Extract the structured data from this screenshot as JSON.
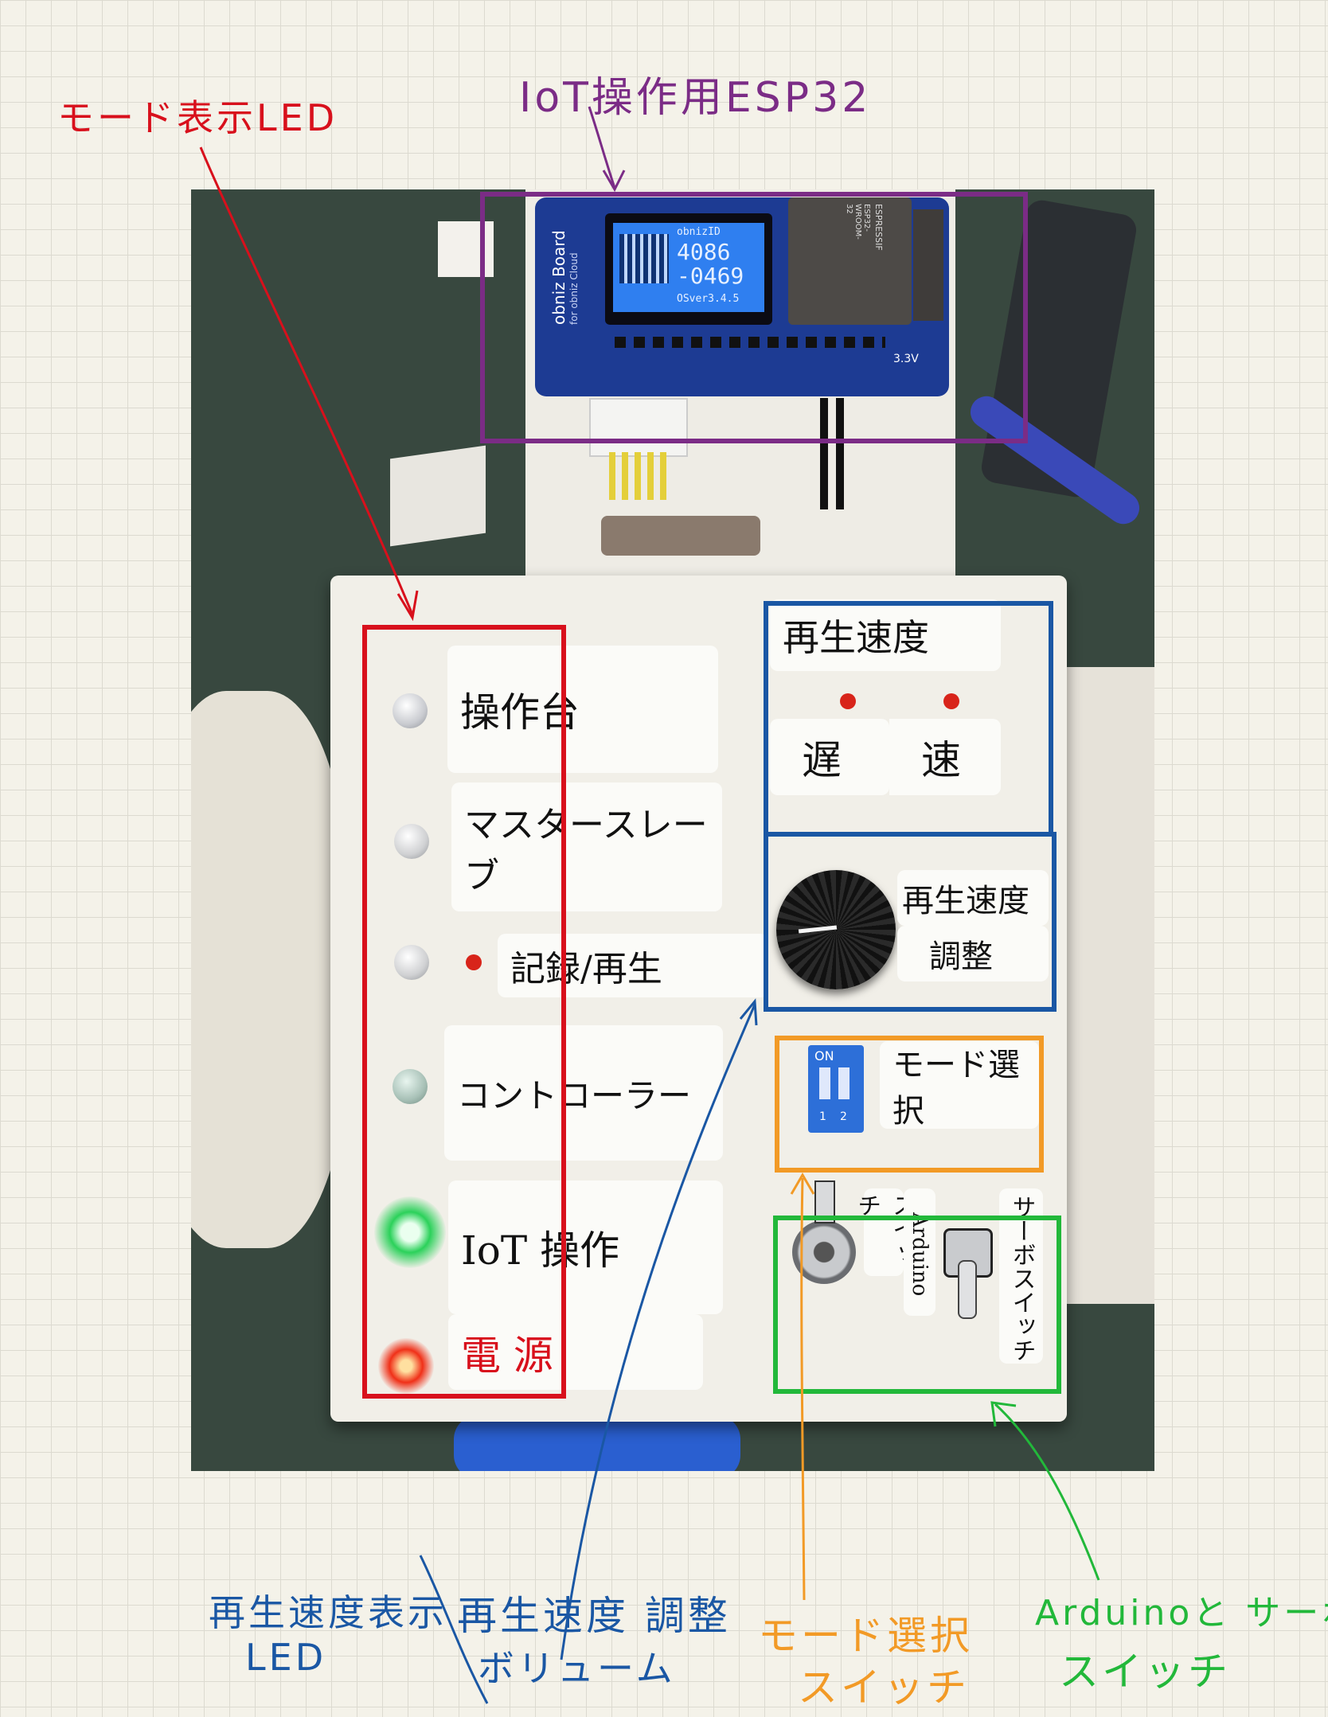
{
  "annotations": {
    "mode_led": "モード表示LED",
    "esp32": "IoT操作用ESP32",
    "speed_led_line1": "再生速度表示",
    "speed_led_line2": "LED",
    "speed_volume_line1": "再生速度 調整",
    "speed_volume_line2": "ボリューム",
    "mode_switch_line1": "モード選択",
    "mode_switch_line2": "スイッチ",
    "arduino_servo_line1": "Arduinoと サーボ",
    "arduino_servo_line2": "スイッチ"
  },
  "board": {
    "brand": "obniz Board",
    "cloud": "for obniz Cloud",
    "obniz_id_label": "obnizID",
    "obniz_id_1": "4086",
    "obniz_id_2": "-0469",
    "os_version": "OSver3.4.5",
    "module_brand": "ESPRESSIF",
    "module_model": "ESP32-WROOM-32",
    "pin_label": "3.3V"
  },
  "panel_labels": {
    "console": "操作台",
    "master_slave": "マスタースレーブ",
    "record_play": "記録/再生",
    "controller": "コントローラー",
    "iot": "IoT 操作",
    "power": "電 源",
    "speed_title": "再生速度",
    "slow": "遅",
    "fast": "速",
    "speed_adjust_1": "再生速度",
    "speed_adjust_2": "調整",
    "dip_on": "ON",
    "dip_1": "1",
    "dip_2": "2",
    "mode_select": "モード選択",
    "arduino_switch_1": "スイッチ",
    "arduino_switch_2": "Arduino",
    "servo_switch": "サーボスイッチ"
  },
  "colors": {
    "red": "#d8101c",
    "purple": "#7b2c86",
    "blue": "#1a57a4",
    "orange": "#f29a26",
    "green": "#22b83a"
  },
  "led_states": {
    "console": "off",
    "master_slave": "off",
    "record_play": "off",
    "controller": "off",
    "iot": "green-on",
    "power": "red-on"
  }
}
